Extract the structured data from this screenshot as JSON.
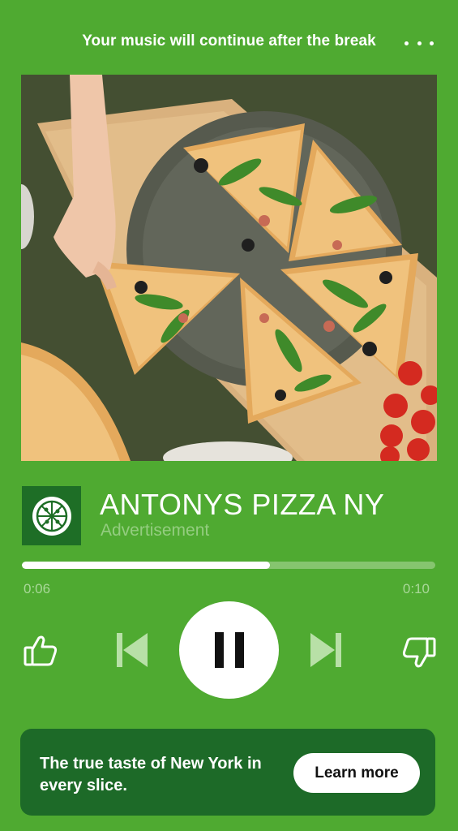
{
  "header": {
    "title": "Your music will continue after the break",
    "more_icon": "more-horizontal-icon"
  },
  "ad": {
    "title": "ANTONYS PIZZA NY",
    "subtitle": "Advertisement",
    "logo_icon": "pizza-logo-icon",
    "artwork_description_icon": "pizza-photo"
  },
  "progress": {
    "elapsed": "0:06",
    "total": "0:10",
    "fraction": 0.6
  },
  "controls": {
    "like_icon": "thumbs-up-icon",
    "prev_icon": "skip-previous-icon",
    "play_icon": "pause-icon",
    "next_icon": "skip-next-icon",
    "dislike_icon": "thumbs-down-icon"
  },
  "cta": {
    "text": "The true taste of New York in every slice.",
    "button_label": "Learn more"
  },
  "colors": {
    "background": "#4faa31",
    "card": "#1d6a28",
    "logo_tile": "#1e6e26"
  }
}
